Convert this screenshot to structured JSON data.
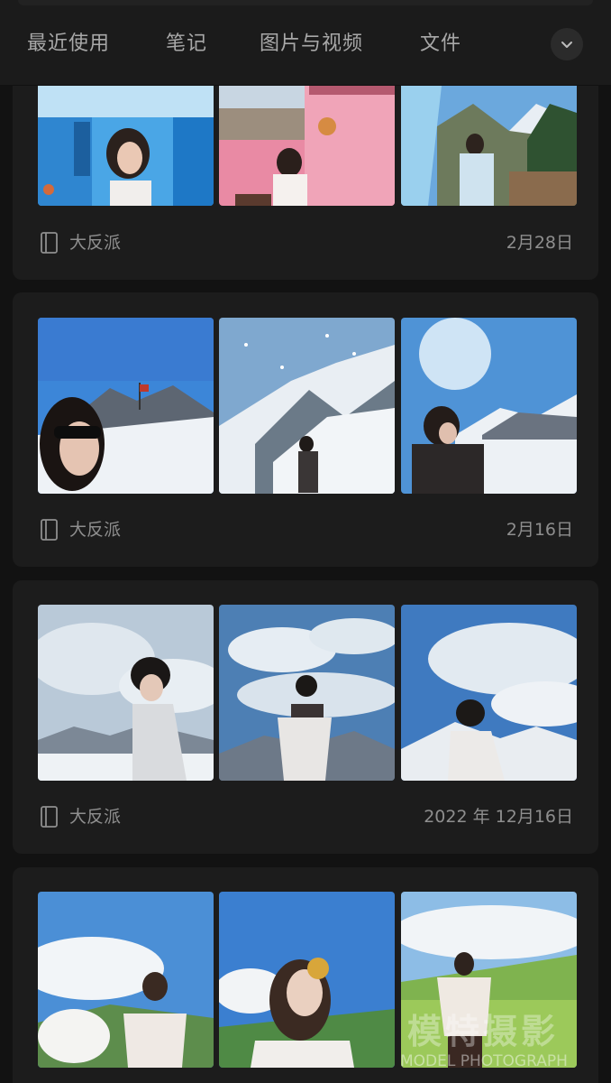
{
  "tabs": {
    "recent": "最近使用",
    "notes": "笔记",
    "media": "图片与视频",
    "files": "文件",
    "expand_icon": "chevron-down-icon"
  },
  "cards": [
    {
      "source": "大反派",
      "date": "2月28日",
      "photos": [
        "blue-town-portrait",
        "pink-wall-portrait",
        "mountain-lake-portrait"
      ]
    },
    {
      "source": "大反派",
      "date": "2月16日",
      "photos": [
        "snow-sunglasses-portrait",
        "snowy-slope-figure",
        "snow-mountain-profile"
      ]
    },
    {
      "source": "大反派",
      "date": "2022 年 12月16日",
      "photos": [
        "cloud-beanie-portrait",
        "cloud-scarf-portrait",
        "cloud-jacket-portrait"
      ]
    },
    {
      "source": "",
      "date": "",
      "photos": [
        "white-horse-portrait",
        "headdress-portrait",
        "grassland-shawl-portrait"
      ]
    }
  ],
  "watermark": {
    "cn": "模特摄影",
    "en": "MODEL PHOTOGRAPH"
  },
  "colors": {
    "background": "#121212",
    "card": "#1c1c1c",
    "topbar": "#1b1b1b",
    "text": "#a8a8a8"
  }
}
